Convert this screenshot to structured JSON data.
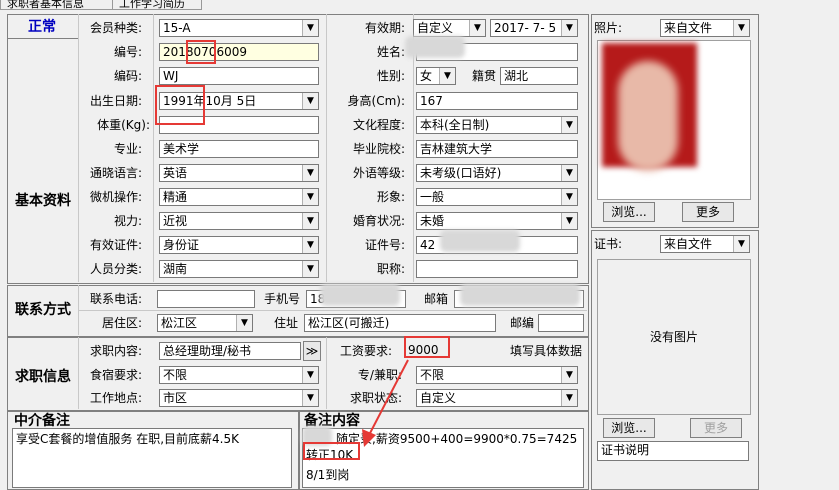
{
  "tabs": [
    "求职者基本信息",
    "工作学习简历"
  ],
  "status": "正常",
  "sections": {
    "basic": "基本资料",
    "contact": "联系方式",
    "job": "求职信息",
    "agent_note": "中介备注",
    "note": "备注内容"
  },
  "fields": {
    "member_type_label": "会员种类:",
    "member_type": "15-A",
    "valid_label": "有效期:",
    "valid_type": "自定义",
    "valid_date": "2017- 7- 5",
    "number_label": "编号:",
    "number": "20180706009",
    "name_label": "姓名:",
    "code_label": "编码:",
    "code": "WJ",
    "gender_label": "性别:",
    "gender": "女",
    "native_label": "籍贯",
    "native": "湖北",
    "birth_label": "出生日期:",
    "birth": "1991年10月 5日",
    "height_label": "身高(Cm):",
    "height": "167",
    "weight_label": "体重(Kg):",
    "edu_label": "文化程度:",
    "edu": "本科(全日制)",
    "major_label": "专业:",
    "major": "美术学",
    "school_label": "毕业院校:",
    "school": "吉林建筑大学",
    "lang_label": "通晓语言:",
    "lang": "英语",
    "lang_level_label": "外语等级:",
    "lang_level": "未考级(口语好)",
    "pc_label": "微机操作:",
    "pc": "精通",
    "look_label": "形象:",
    "look": "一般",
    "vision_label": "视力:",
    "vision": "近视",
    "marital_label": "婚育状况:",
    "marital": "未婚",
    "id_type_label": "有效证件:",
    "id_type": "身份证",
    "id_no_label": "证件号:",
    "id_no": "42",
    "category_label": "人员分类:",
    "category": "湖南",
    "title_label": "职称:"
  },
  "contact": {
    "phone_label": "联系电话:",
    "mobile_label": "手机号",
    "mobile": "18",
    "email_label": "邮箱",
    "district_label": "居住区:",
    "district": "松江区",
    "address_label": "住址",
    "address": "松江区(可搬迁)",
    "zip_label": "邮编"
  },
  "job": {
    "content_label": "求职内容:",
    "content": "总经理助理/秘书",
    "more": "≫",
    "salary_label": "工资要求:",
    "salary": "9000",
    "salary_hint": "填写具体数据",
    "meal_label": "食宿要求:",
    "meal": "不限",
    "parttime_label": "专/兼职:",
    "parttime": "不限",
    "location_label": "工作地点:",
    "location": "市区",
    "job_status_label": "求职状态:",
    "job_status": "自定义"
  },
  "notes": {
    "agent": "享受C套餐的增值服务  在职,目前底薪4.5K",
    "line1": "随定录,薪资9500+400=9900*0.75=7425",
    "line2": "转正10K",
    "line3": "8/1到岗"
  },
  "photo": {
    "label": "照片:",
    "source": "来自文件",
    "browse": "浏览...",
    "more": "更多"
  },
  "cert": {
    "label": "证书:",
    "source": "来自文件",
    "empty": "没有图片",
    "browse": "浏览...",
    "more": "更多",
    "desc": "证书说明"
  }
}
